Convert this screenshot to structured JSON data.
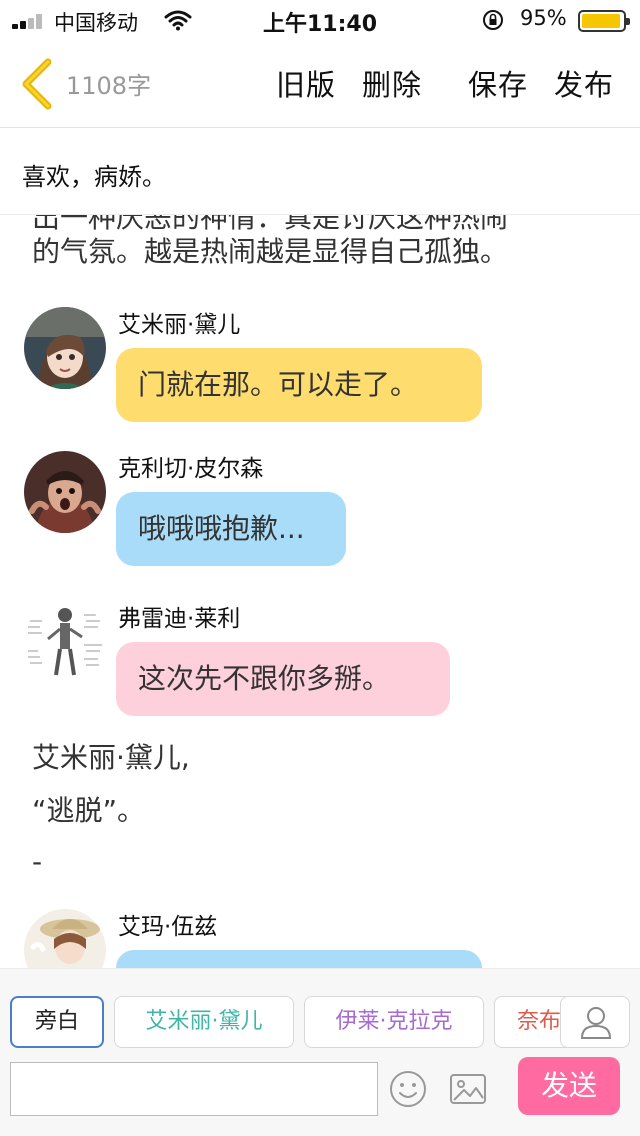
{
  "status_bar": {
    "carrier": "中国移动",
    "time": "上午11:40",
    "battery_percent_text": "95%",
    "battery_level": 0.95,
    "battery_color": "#f6c600"
  },
  "nav": {
    "back_icon": "chevron-left-icon",
    "word_count": "1108字",
    "old_version": "旧版",
    "delete": "删除",
    "save": "保存",
    "publish": "发布",
    "accent_color": "#f2c200"
  },
  "story": {
    "title": "喜欢，病娇。",
    "narration_top_line1": "出一种厌恶的神情：真是讨厌这种热闹",
    "narration_top_line2": "的气氛。越是热闹越是显得自己孤独。",
    "messages": [
      {
        "speaker": "艾米丽·黛儿",
        "text": "门就在那。可以走了。",
        "bubble_color": "#ffdc6e"
      },
      {
        "speaker": "克利切·皮尔森",
        "text": "哦哦哦抱歉...",
        "bubble_color": "#a8dcf8"
      },
      {
        "speaker": "弗雷迪·莱利",
        "text": "这次先不跟你多掰。",
        "bubble_color": "#fdd0dc"
      },
      {
        "speaker": "艾玛·伍兹",
        "text": "",
        "bubble_color": "#a8dcf8"
      }
    ],
    "narration_mid_line1": "艾米丽·黛儿,",
    "narration_mid_line2": "“逃脱”。",
    "narration_dash": "-"
  },
  "composer": {
    "roles": [
      {
        "label": "旁白",
        "color": "#222222"
      },
      {
        "label": "艾米丽·黛儿",
        "color": "#3fb6a8"
      },
      {
        "label": "伊莱·克拉克",
        "color": "#a66ad0"
      },
      {
        "label": "奈布",
        "color": "#e05a4a"
      }
    ],
    "input_value": "",
    "input_placeholder": "",
    "send_label": "发送",
    "send_color": "#ff6aa0",
    "add_role_icon": "person-icon",
    "emoji_icon": "smiley-icon",
    "image_icon": "image-icon"
  }
}
